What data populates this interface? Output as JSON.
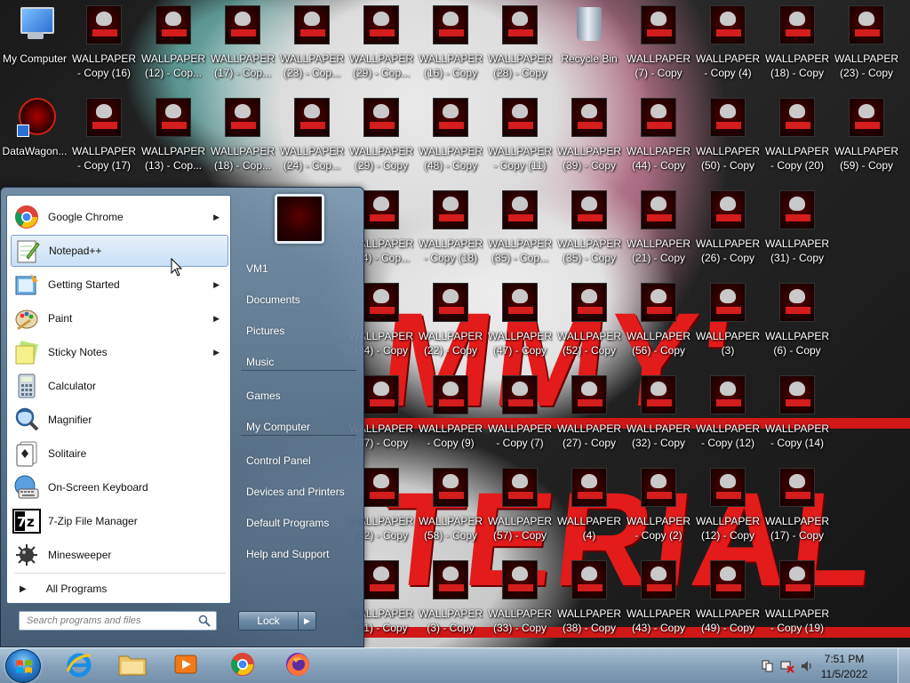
{
  "desktop": {
    "wallpaper_words": [
      "MMY'",
      "TERIAL"
    ],
    "icons": [
      {
        "name": "icon-my-computer",
        "label": "My Computer",
        "kind": "mycomp"
      },
      {
        "name": "icon-datawagon",
        "label": "DataWagon...",
        "kind": "datawagon"
      },
      {
        "name": "icon-wallpaper",
        "label": "WALLPAPER - Copy (16)",
        "kind": "wall"
      },
      {
        "name": "icon-wallpaper",
        "label": "WALLPAPER - Copy (17)",
        "kind": "wall"
      },
      {
        "name": "icon-wallpaper",
        "label": "WALLPAPER (12) - Cop...",
        "kind": "wall"
      },
      {
        "name": "icon-wallpaper",
        "label": "WALLPAPER (13) - Cop...",
        "kind": "wall"
      },
      {
        "name": "icon-wallpaper",
        "label": "WALLPAPER (17) - Cop...",
        "kind": "wall"
      },
      {
        "name": "icon-wallpaper",
        "label": "WALLPAPER (18) - Cop...",
        "kind": "wall"
      },
      {
        "name": "icon-wallpaper",
        "label": "WALLPAPER (23) - Cop...",
        "kind": "wall"
      },
      {
        "name": "icon-wallpaper",
        "label": "WALLPAPER (24) - Cop...",
        "kind": "wall"
      },
      {
        "name": "icon-wallpaper",
        "label": "WALLPAPER (29) - Cop...",
        "kind": "wall"
      },
      {
        "name": "icon-wallpaper",
        "label": "WALLPAPER (29) - Copy",
        "kind": "wall"
      },
      {
        "name": "icon-wallpaper",
        "label": "WALLPAPER (34) - Cop...",
        "kind": "wall"
      },
      {
        "name": "icon-wallpaper",
        "label": "WALLPAPER (34) - Copy",
        "kind": "wall"
      },
      {
        "name": "icon-wallpaper",
        "label": "WALLPAPER (37) - Copy",
        "kind": "wall"
      },
      {
        "name": "icon-wallpaper",
        "label": "WALLPAPER (42) - Copy",
        "kind": "wall"
      },
      {
        "name": "icon-wallpaper",
        "label": "WALLPAPER (11) - Copy",
        "kind": "wall"
      },
      {
        "name": "icon-wallpaper",
        "label": "WALLPAPER (16) - Copy",
        "kind": "wall"
      },
      {
        "name": "icon-wallpaper",
        "label": "WALLPAPER (48) - Copy",
        "kind": "wall"
      },
      {
        "name": "icon-wallpaper",
        "label": "WALLPAPER - Copy (18)",
        "kind": "wall"
      },
      {
        "name": "icon-wallpaper",
        "label": "WALLPAPER (22) - Copy",
        "kind": "wall"
      },
      {
        "name": "icon-wallpaper",
        "label": "WALLPAPER - Copy (9)",
        "kind": "wall"
      },
      {
        "name": "icon-wallpaper",
        "label": "WALLPAPER (58) - Copy",
        "kind": "wall"
      },
      {
        "name": "icon-wallpaper",
        "label": "WALLPAPER (3) - Copy",
        "kind": "wall"
      },
      {
        "name": "icon-wallpaper",
        "label": "WALLPAPER (28) - Copy",
        "kind": "wall"
      },
      {
        "name": "icon-wallpaper",
        "label": "WALLPAPER - Copy (11)",
        "kind": "wall"
      },
      {
        "name": "icon-wallpaper",
        "label": "WALLPAPER (35) - Cop...",
        "kind": "wall"
      },
      {
        "name": "icon-wallpaper",
        "label": "WALLPAPER (47) - Copy",
        "kind": "wall"
      },
      {
        "name": "icon-wallpaper",
        "label": "WALLPAPER - Copy (7)",
        "kind": "wall"
      },
      {
        "name": "icon-wallpaper",
        "label": "WALLPAPER (57) - Copy",
        "kind": "wall"
      },
      {
        "name": "icon-wallpaper",
        "label": "WALLPAPER (33) - Copy",
        "kind": "wall"
      },
      {
        "name": "icon-recycle-bin",
        "label": "Recycle Bin",
        "kind": "recycle"
      },
      {
        "name": "icon-wallpaper",
        "label": "WALLPAPER (39) - Copy",
        "kind": "wall"
      },
      {
        "name": "icon-wallpaper",
        "label": "WALLPAPER (35) - Copy",
        "kind": "wall"
      },
      {
        "name": "icon-wallpaper",
        "label": "WALLPAPER (52) - Copy",
        "kind": "wall"
      },
      {
        "name": "icon-wallpaper",
        "label": "WALLPAPER (27) - Copy",
        "kind": "wall"
      },
      {
        "name": "icon-wallpaper",
        "label": "WALLPAPER (4)",
        "kind": "wall"
      },
      {
        "name": "icon-wallpaper",
        "label": "WALLPAPER (38) - Copy",
        "kind": "wall"
      },
      {
        "name": "icon-wallpaper",
        "label": "WALLPAPER (7) - Copy",
        "kind": "wall"
      },
      {
        "name": "icon-wallpaper",
        "label": "WALLPAPER (44) - Copy",
        "kind": "wall"
      },
      {
        "name": "icon-wallpaper",
        "label": "WALLPAPER (21) - Copy",
        "kind": "wall"
      },
      {
        "name": "icon-wallpaper",
        "label": "WALLPAPER (56) - Copy",
        "kind": "wall"
      },
      {
        "name": "icon-wallpaper",
        "label": "WALLPAPER (32) - Copy",
        "kind": "wall"
      },
      {
        "name": "icon-wallpaper",
        "label": "WALLPAPER - Copy (2)",
        "kind": "wall"
      },
      {
        "name": "icon-wallpaper",
        "label": "WALLPAPER (43) - Copy",
        "kind": "wall"
      },
      {
        "name": "icon-wallpaper",
        "label": "WALLPAPER - Copy (4)",
        "kind": "wall"
      },
      {
        "name": "icon-wallpaper",
        "label": "WALLPAPER (50) - Copy",
        "kind": "wall"
      },
      {
        "name": "icon-wallpaper",
        "label": "WALLPAPER (26) - Copy",
        "kind": "wall"
      },
      {
        "name": "icon-wallpaper",
        "label": "WALLPAPER (3)",
        "kind": "wall"
      },
      {
        "name": "icon-wallpaper",
        "label": "WALLPAPER - Copy (12)",
        "kind": "wall"
      },
      {
        "name": "icon-wallpaper",
        "label": "WALLPAPER (12) - Copy",
        "kind": "wall"
      },
      {
        "name": "icon-wallpaper",
        "label": "WALLPAPER (49) - Copy",
        "kind": "wall"
      },
      {
        "name": "icon-wallpaper",
        "label": "WALLPAPER (18) - Copy",
        "kind": "wall"
      },
      {
        "name": "icon-wallpaper",
        "label": "WALLPAPER - Copy (20)",
        "kind": "wall"
      },
      {
        "name": "icon-wallpaper",
        "label": "WALLPAPER (31) - Copy",
        "kind": "wall"
      },
      {
        "name": "icon-wallpaper",
        "label": "WALLPAPER (6) - Copy",
        "kind": "wall"
      },
      {
        "name": "icon-wallpaper",
        "label": "WALLPAPER - Copy (14)",
        "kind": "wall"
      },
      {
        "name": "icon-wallpaper",
        "label": "WALLPAPER (17) - Copy",
        "kind": "wall"
      },
      {
        "name": "icon-wallpaper",
        "label": "WALLPAPER - Copy (19)",
        "kind": "wall"
      },
      {
        "name": "icon-wallpaper",
        "label": "WALLPAPER (23) - Copy",
        "kind": "wall"
      },
      {
        "name": "icon-wallpaper",
        "label": "WALLPAPER (59) - Copy",
        "kind": "wall"
      }
    ]
  },
  "start_menu": {
    "programs": [
      {
        "label": "Google Chrome",
        "icon": "chrome-icon",
        "has_arrow": true,
        "hover": false
      },
      {
        "label": "Notepad++",
        "icon": "notepad-plus-plus-icon",
        "has_arrow": false,
        "hover": true
      },
      {
        "label": "Getting Started",
        "icon": "getting-started-icon",
        "has_arrow": true,
        "hover": false
      },
      {
        "label": "Paint",
        "icon": "paint-icon",
        "has_arrow": true,
        "hover": false
      },
      {
        "label": "Sticky Notes",
        "icon": "sticky-notes-icon",
        "has_arrow": true,
        "hover": false
      },
      {
        "label": "Calculator",
        "icon": "calculator-icon",
        "has_arrow": false,
        "hover": false
      },
      {
        "label": "Magnifier",
        "icon": "magnifier-icon",
        "has_arrow": false,
        "hover": false
      },
      {
        "label": "Solitaire",
        "icon": "solitaire-icon",
        "has_arrow": false,
        "hover": false
      },
      {
        "label": "On-Screen Keyboard",
        "icon": "keyboard-icon",
        "has_arrow": false,
        "hover": false
      },
      {
        "label": "7-Zip File Manager",
        "icon": "seven-zip-icon",
        "has_arrow": false,
        "hover": false
      },
      {
        "label": "Minesweeper",
        "icon": "minesweeper-icon",
        "has_arrow": false,
        "hover": false
      }
    ],
    "all_programs_label": "All Programs",
    "search_placeholder": "Search programs and files",
    "right_links": [
      {
        "label": "VM1",
        "group": 0
      },
      {
        "label": "Documents",
        "group": 0
      },
      {
        "label": "Pictures",
        "group": 0
      },
      {
        "label": "Music",
        "group": 0
      },
      {
        "label": "Games",
        "group": 1
      },
      {
        "label": "My Computer",
        "group": 1
      },
      {
        "label": "Control Panel",
        "group": 2
      },
      {
        "label": "Devices and Printers",
        "group": 2
      },
      {
        "label": "Default Programs",
        "group": 2
      },
      {
        "label": "Help and Support",
        "group": 2
      }
    ],
    "lock_label": "Lock"
  },
  "taskbar": {
    "pinned": [
      {
        "name": "taskbar-internet-explorer",
        "icon": "internet-explorer-icon"
      },
      {
        "name": "taskbar-file-explorer",
        "icon": "folder-icon"
      },
      {
        "name": "taskbar-media-player",
        "icon": "media-player-icon"
      },
      {
        "name": "taskbar-chrome",
        "icon": "chrome-icon"
      },
      {
        "name": "taskbar-firefox",
        "icon": "firefox-icon"
      }
    ],
    "clock": {
      "time": "7:51 PM",
      "date": "11/5/2022"
    }
  }
}
